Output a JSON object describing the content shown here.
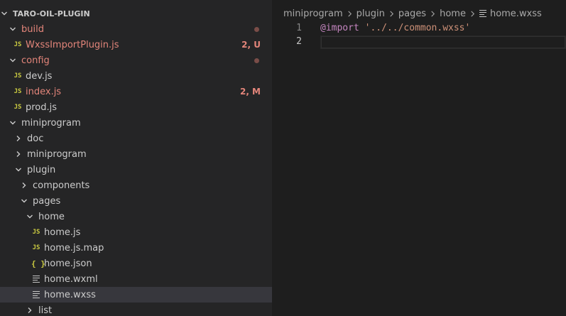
{
  "explorer": {
    "root_label": "TARO-OIL-PLUGIN",
    "items": [
      {
        "label": "build",
        "type": "folder",
        "open": true,
        "modified": true
      },
      {
        "label": "WxssImportPlugin.js",
        "type": "js",
        "badge": "2, U",
        "modified": true
      },
      {
        "label": "config",
        "type": "folder",
        "open": true,
        "modified": true
      },
      {
        "label": "dev.js",
        "type": "js"
      },
      {
        "label": "index.js",
        "type": "js",
        "badge": "2, M",
        "modified": true
      },
      {
        "label": "prod.js",
        "type": "js"
      },
      {
        "label": "miniprogram",
        "type": "folder",
        "open": true
      },
      {
        "label": "doc",
        "type": "folder",
        "open": false
      },
      {
        "label": "miniprogram",
        "type": "folder",
        "open": false
      },
      {
        "label": "plugin",
        "type": "folder",
        "open": true
      },
      {
        "label": "components",
        "type": "folder",
        "open": false
      },
      {
        "label": "pages",
        "type": "folder",
        "open": true
      },
      {
        "label": "home",
        "type": "folder",
        "open": true
      },
      {
        "label": "home.js",
        "type": "js"
      },
      {
        "label": "home.js.map",
        "type": "js"
      },
      {
        "label": "home.json",
        "type": "json"
      },
      {
        "label": "home.wxml",
        "type": "lines"
      },
      {
        "label": "home.wxss",
        "type": "lines",
        "selected": true
      },
      {
        "label": "list",
        "type": "folder",
        "open": false
      }
    ],
    "icon_text": {
      "js": "JS",
      "json": "{ }"
    }
  },
  "breadcrumb": [
    "miniprogram",
    "plugin",
    "pages",
    "home",
    "home.wxss"
  ],
  "editor": {
    "lines": [
      {
        "number": "1",
        "keyword": "@import",
        "space": " ",
        "string": "'../../common.wxss'"
      },
      {
        "number": "2",
        "keyword": "",
        "space": "",
        "string": ""
      }
    ]
  },
  "colors": {
    "modified": "#e3857a",
    "js_icon": "#cbcb41",
    "sidebar_bg": "#252526",
    "editor_bg": "#1e1e1e",
    "selected_bg": "#37373d"
  }
}
